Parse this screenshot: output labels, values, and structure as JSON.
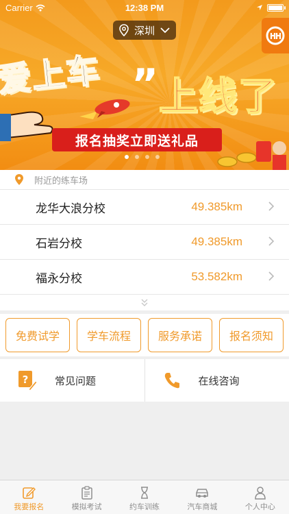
{
  "status_bar": {
    "carrier": "Carrier",
    "time": "12:38 PM"
  },
  "banner": {
    "city": "深圳",
    "title_left": "爱上车",
    "quote_mark": "”",
    "title_right": "上线了",
    "cta": "报名抽奖立即送礼品",
    "pages": 4,
    "active_page": 0
  },
  "nearby": {
    "header": "附近的练车场",
    "schools": [
      {
        "name": "龙华大浪分校",
        "distance": "49.385km"
      },
      {
        "name": "石岩分校",
        "distance": "49.385km"
      },
      {
        "name": "福永分校",
        "distance": "53.582km"
      }
    ]
  },
  "actions": [
    "免费试学",
    "学车流程",
    "服务承诺",
    "报名须知"
  ],
  "help": {
    "faq": "常见问题",
    "consult": "在线咨询"
  },
  "tabs": [
    {
      "label": "我要报名",
      "icon": "edit-icon",
      "active": true
    },
    {
      "label": "模拟考试",
      "icon": "clipboard-icon",
      "active": false
    },
    {
      "label": "约车训练",
      "icon": "hourglass-icon",
      "active": false
    },
    {
      "label": "汽车商城",
      "icon": "car-icon",
      "active": false
    },
    {
      "label": "个人中心",
      "icon": "person-icon",
      "active": false
    }
  ],
  "colors": {
    "accent": "#f09a2b",
    "banner": "#f39a1c",
    "cta": "#d91f1b"
  }
}
